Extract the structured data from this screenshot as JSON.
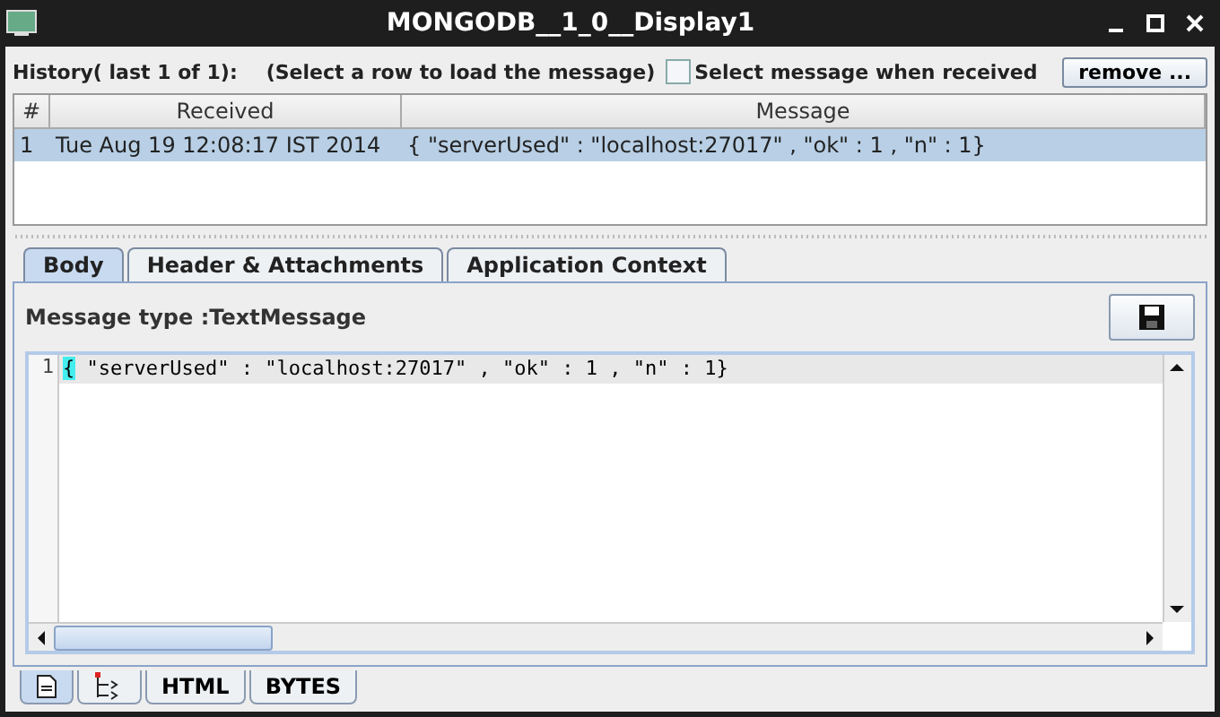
{
  "window": {
    "title": "MONGODB__1_0__Display1"
  },
  "history": {
    "label": "History( last 1 of 1):",
    "hint": "(Select a row to load the message)",
    "auto_select": {
      "label": "Select message when received",
      "checked": false
    },
    "remove_button": "remove ..."
  },
  "table": {
    "columns": [
      "#",
      "Received",
      "Message"
    ],
    "rows": [
      {
        "cells": [
          "1",
          "Tue Aug 19 12:08:17 IST 2014",
          "{ \"serverUsed\" : \"localhost:27017\" , \"ok\" : 1 , \"n\" : 1}"
        ],
        "selected": true
      }
    ]
  },
  "tabs": [
    {
      "label": "Body",
      "selected": true
    },
    {
      "label": "Header & Attachments",
      "selected": false
    },
    {
      "label": "Application Context",
      "selected": false
    }
  ],
  "message_type": "Message type :TextMessage",
  "editor": {
    "lines": [
      {
        "number": "1",
        "text": "{ \"serverUsed\" : \"localhost:27017\" , \"ok\" : 1 , \"n\" : 1}"
      }
    ]
  },
  "view_tabs": [
    {
      "kind": "document",
      "selected": true
    },
    {
      "kind": "tree",
      "selected": false
    },
    {
      "kind": "text",
      "label": "HTML",
      "selected": false
    },
    {
      "kind": "text",
      "label": "BYTES",
      "selected": false
    }
  ]
}
